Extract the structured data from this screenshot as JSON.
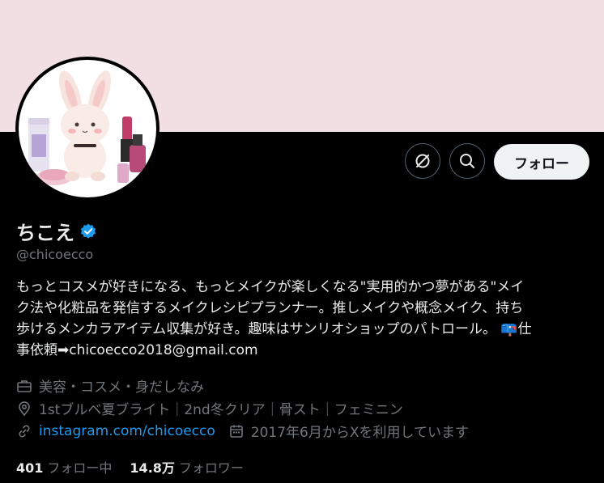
{
  "profile": {
    "display_name": "ちこえ",
    "handle": "@chicoecco",
    "bio_lines": [
      "もっとコスメが好きになる、もっとメイクが楽しくなる\"実用的かつ夢がある\"メイ",
      "ク法や化粧品を発信するメイクレシピプランナー。推しメイクや概念メイク、持ち",
      "歩けるメンカラアイテム収集が好き。趣味はサンリオショップのパトロール。 📪仕",
      "事依頼➡chicoecco2018@gmail.com"
    ],
    "category": "美容・コスメ・身だしなみ",
    "location": "1stブルベ夏ブライト｜2nd冬クリア｜骨スト｜フェミニン",
    "website": "instagram.com/chicoecco",
    "joined": "2017年6月からXを利用しています"
  },
  "actions": {
    "follow_label": "フォロー"
  },
  "stats": {
    "following_count": "401",
    "following_label": "フォロー中",
    "followers_count": "14.8万",
    "followers_label": "フォロワー"
  },
  "icons": {
    "more": "grok-icon",
    "search": "search-icon",
    "verified": "verified-badge-icon",
    "category": "briefcase-icon",
    "location": "location-pin-icon",
    "website": "link-icon",
    "joined": "calendar-icon"
  },
  "colors": {
    "banner": "#f1dfe4",
    "background": "#000000",
    "accent": "#1d9bf0",
    "muted": "#71767b",
    "text": "#e7e9ea"
  }
}
